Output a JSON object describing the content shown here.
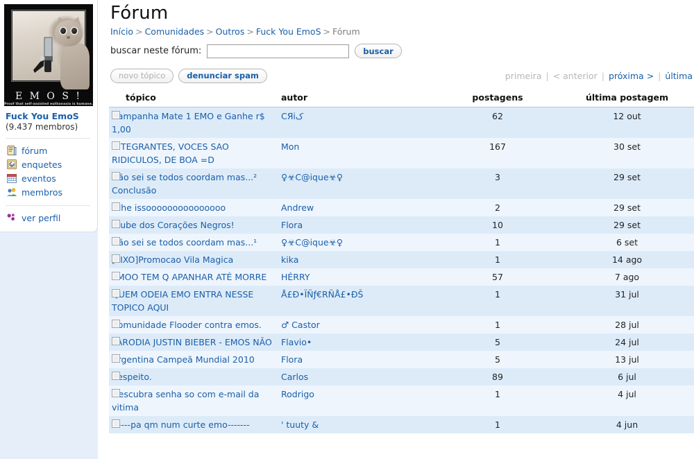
{
  "community": {
    "avatar_caption": "E M O S !",
    "avatar_subcaption": "Proof that self-assisted euthanasia is humane.",
    "name": "Fuck You EmoS",
    "members": "(9.437 membros)"
  },
  "sidebar": {
    "items": [
      {
        "label": "fórum",
        "icon": "forum-icon"
      },
      {
        "label": "enquetes",
        "icon": "poll-icon"
      },
      {
        "label": "eventos",
        "icon": "calendar-icon"
      },
      {
        "label": "membros",
        "icon": "members-icon"
      }
    ],
    "profile": {
      "label": "ver perfil",
      "icon": "profile-icon"
    }
  },
  "header": {
    "title": "Fórum",
    "breadcrumb": [
      {
        "label": "Início",
        "link": true
      },
      {
        "label": "Comunidades",
        "link": true
      },
      {
        "label": "Outros",
        "link": true
      },
      {
        "label": "Fuck You EmoS",
        "link": true
      },
      {
        "label": "Fórum",
        "link": false
      }
    ]
  },
  "search": {
    "label": "buscar neste fórum:",
    "value": "",
    "placeholder": "",
    "button": "buscar"
  },
  "toolbar": {
    "new_topic": "novo tópico",
    "new_topic_disabled": true,
    "report_spam": "denunciar spam"
  },
  "pager": {
    "first": {
      "label": "primeira",
      "enabled": false
    },
    "previous": {
      "label": "< anterior",
      "enabled": false
    },
    "next": {
      "label": "próxima >",
      "enabled": true
    },
    "last": {
      "label": "última",
      "enabled": true
    },
    "separator": "|"
  },
  "table": {
    "columns": [
      "tópico",
      "autor",
      "postagens",
      "última postagem"
    ],
    "rows": [
      {
        "topic": "Campanha Mate 1 EMO e Ganhe r$ 1,00",
        "author": "CЯiک",
        "posts": "62",
        "last": "12 out"
      },
      {
        "topic": "INTEGRANTES, VOCES SAO RIDICULOS, DE BOA =D",
        "author": "Mon",
        "posts": "167",
        "last": "30 set"
      },
      {
        "topic": "Não sei se todos coordam mas...² Conclusão",
        "author": "♀☣C@ique☣♀",
        "posts": "3",
        "last": "29 set"
      },
      {
        "topic": "Olhe issooooooooooooooo",
        "author": "Andrew",
        "posts": "2",
        "last": "29 set"
      },
      {
        "topic": "Clube dos Corações Negros!",
        "author": "Flora",
        "posts": "10",
        "last": "29 set"
      },
      {
        "topic": "Não sei se todos coordam mas...¹",
        "author": "♀☣C@ique☣♀",
        "posts": "1",
        "last": "6 set"
      },
      {
        "topic": "[FIXO]Promocao Vila Magica",
        "author": "kika",
        "posts": "1",
        "last": "14 ago"
      },
      {
        "topic": "EMOO TEM Q APANHAR ATÉ MORRE",
        "author": "HÉRRY",
        "posts": "57",
        "last": "7 ago"
      },
      {
        "topic": "QUEM ODEIA EMO ENTRA NESSE TOPICO AQUI",
        "author": "Å£Ð•ÏÑƒ€RÑÅ£•ÐŠ",
        "posts": "1",
        "last": "31 jul"
      },
      {
        "topic": "Comunidade Flooder contra emos.",
        "author": "♂ Castor",
        "posts": "1",
        "last": "28 jul"
      },
      {
        "topic": "PARODIA JUSTIN BIEBER - EMOS NÃO",
        "author": "Flavio•",
        "posts": "5",
        "last": "24 jul"
      },
      {
        "topic": "Argentina Campeã Mundial 2010",
        "author": "Flora",
        "posts": "5",
        "last": "13 jul"
      },
      {
        "topic": "Respeito.",
        "author": "Carlos",
        "posts": "89",
        "last": "6 jul"
      },
      {
        "topic": "Descubra senha so com e-mail da vitima",
        "author": "Rodrigo",
        "posts": "1",
        "last": "4 jul"
      },
      {
        "topic": "------pa qm num curte emo-------",
        "author": "' tuuty &",
        "posts": "1",
        "last": "4 jun"
      }
    ]
  },
  "colors": {
    "link": "#1a5fa8",
    "row_odd": "#ddebf9",
    "row_even": "#eef5fd",
    "sidebar_bg": "#e6eefa",
    "header_rule": "#a8c6e4",
    "disabled": "#b6b6b6"
  }
}
